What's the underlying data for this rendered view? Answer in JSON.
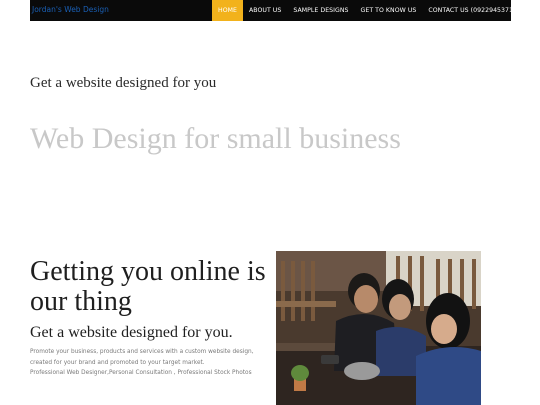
{
  "nav": {
    "brand": "Jordan's Web Design",
    "items": [
      {
        "label": "HOME",
        "active": true
      },
      {
        "label": "ABOUT US",
        "active": false
      },
      {
        "label": "SAMPLE DESIGNS",
        "active": false
      },
      {
        "label": "GET TO KNOW US",
        "active": false
      },
      {
        "label": "CONTACT US (09229453718)",
        "active": false
      }
    ],
    "active_color": "#f2b21c"
  },
  "hero": {
    "subtitle": "Get a website designed for you",
    "title": "Web Design for small business"
  },
  "section": {
    "heading": "Getting you online is our thing",
    "subheading": "Get a website designed for you.",
    "body_lines": [
      "Promote your business, products and services with a custom website design,",
      "created for your brand and promoted to your target market.",
      "Professional Web Designer,Personal Consultation , Professional Stock Photos"
    ]
  },
  "photo": {
    "icon": "people-at-cafe-photo"
  }
}
